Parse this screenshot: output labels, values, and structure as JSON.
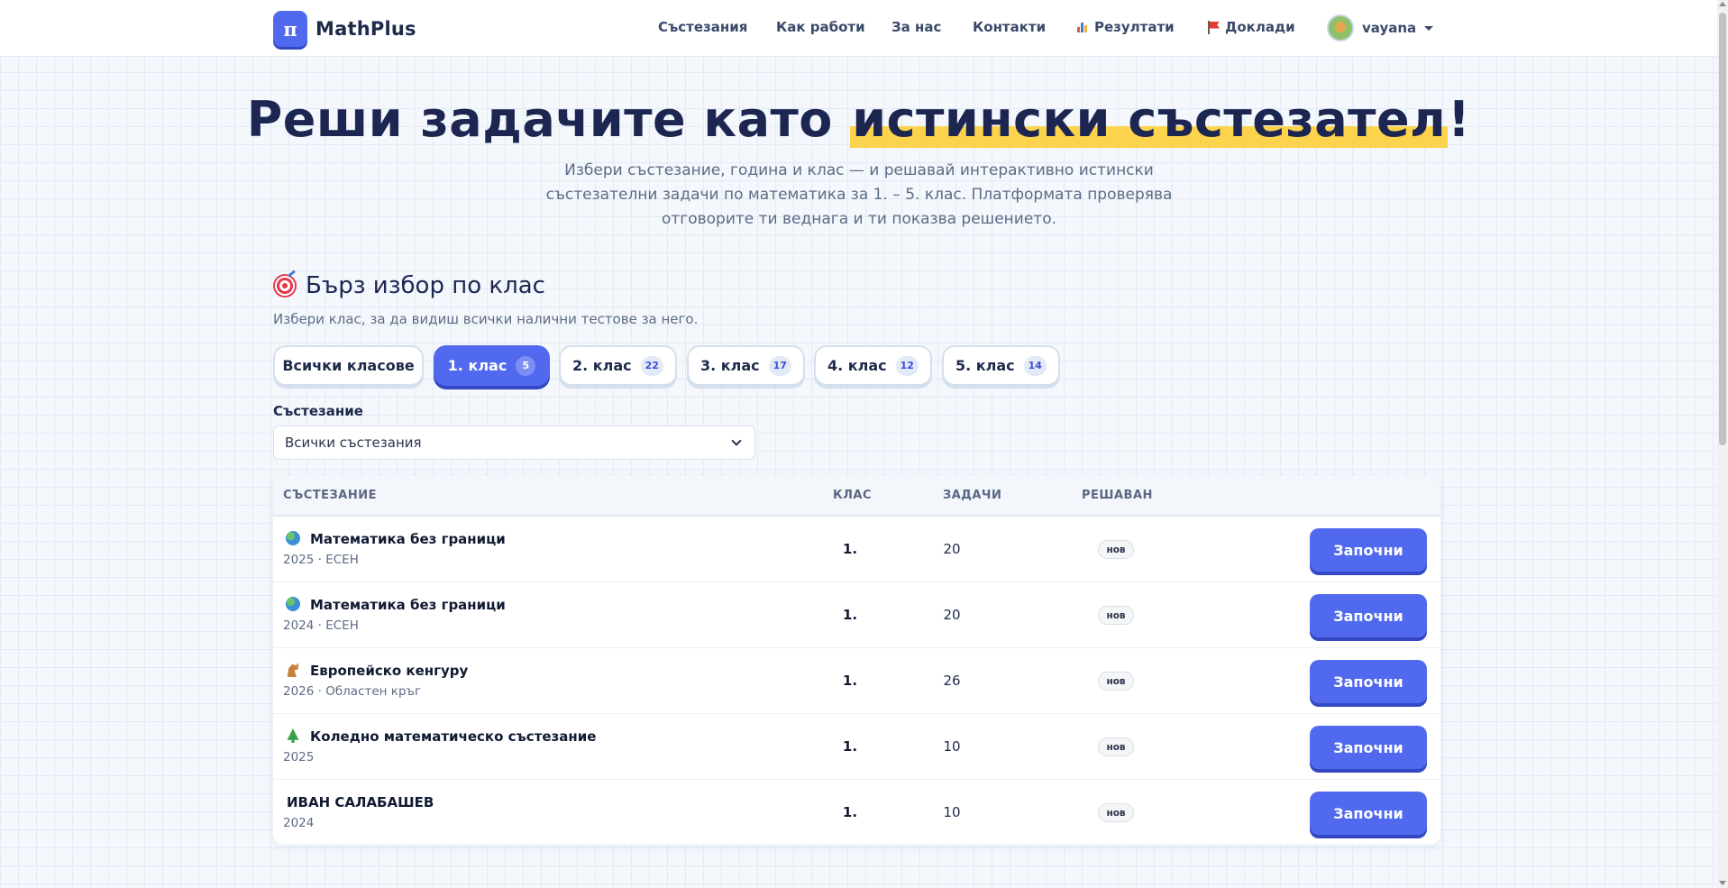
{
  "brand": {
    "logo_glyph": "π",
    "name": "MathPlus",
    "accent": "#5069ee",
    "accent_dark": "#3448c4",
    "highlight": "#fcd34d"
  },
  "nav": {
    "items": [
      {
        "label": "Състезания"
      },
      {
        "label": "Как работи"
      },
      {
        "label": "За нас"
      },
      {
        "label": "Контакти"
      },
      {
        "label": "Резултати",
        "icon": "bar-chart-icon"
      },
      {
        "label": "Доклади",
        "icon": "red-flag-icon"
      }
    ],
    "user": {
      "name": "vayana",
      "avatar_icon": "user-avatar-icon"
    }
  },
  "hero": {
    "title_before": "Реши задачите като ",
    "title_highlight": "истински състезател",
    "title_after": "!",
    "subtitle": "Избери състезание, година и клас — и решавай интерактивно истински състезателни задачи по математика за 1. – 5. клас. Платформата проверява отговорите ти веднага и ти показва решението."
  },
  "quick_pick": {
    "icon": "target-icon",
    "title": "Бърз избор по клас",
    "description": "Избери клас, за да видиш всички налични тестове за него.",
    "pills": [
      {
        "label": "Всички класове",
        "count": null,
        "active": false
      },
      {
        "label": "1. клас",
        "count": "5",
        "active": true
      },
      {
        "label": "2. клас",
        "count": "22",
        "active": false
      },
      {
        "label": "3. клас",
        "count": "17",
        "active": false
      },
      {
        "label": "4. клас",
        "count": "12",
        "active": false
      },
      {
        "label": "5. клас",
        "count": "14",
        "active": false
      }
    ]
  },
  "filter": {
    "label": "Състезание",
    "selected": "Всички състезания"
  },
  "table": {
    "headers": {
      "competition": "СЪСТЕЗАНИЕ",
      "grade": "КЛАС",
      "tasks": "ЗАДАЧИ",
      "solved": "РЕШАВАН"
    },
    "rows": [
      {
        "icon": "globe-icon",
        "name": "Математика без граници",
        "meta": "2025 · ЕСЕН",
        "grade": "1.",
        "tasks": "20",
        "status": "нов",
        "action": "Започни"
      },
      {
        "icon": "globe-icon",
        "name": "Математика без граници",
        "meta": "2024 · ЕСЕН",
        "grade": "1.",
        "tasks": "20",
        "status": "нов",
        "action": "Започни"
      },
      {
        "icon": "kangaroo-icon",
        "name": "Европейско кенгуру",
        "meta": "2026 · Областен кръг",
        "grade": "1.",
        "tasks": "26",
        "status": "нов",
        "action": "Започни"
      },
      {
        "icon": "christmas-tree-icon",
        "name": "Коледно математическо състезание",
        "meta": "2025",
        "grade": "1.",
        "tasks": "10",
        "status": "нов",
        "action": "Започни"
      },
      {
        "icon": null,
        "name": "ИВАН САЛАБАШЕВ",
        "meta": "2024",
        "grade": "1.",
        "tasks": "10",
        "status": "нов",
        "action": "Започни"
      }
    ]
  }
}
